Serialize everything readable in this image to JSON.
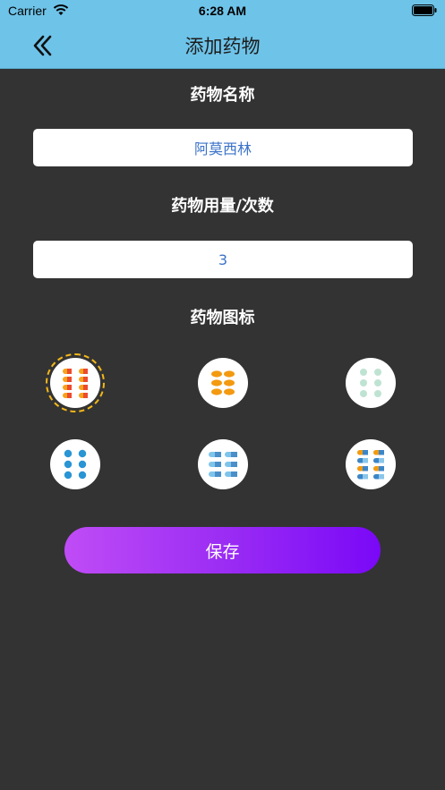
{
  "status_bar": {
    "carrier": "Carrier",
    "time": "6:28 AM"
  },
  "header": {
    "title": "添加药物",
    "back_icon": "double-chevron-left-icon",
    "background": "#6ec3e8"
  },
  "form": {
    "name_label": "药物名称",
    "name_value": "阿莫西林",
    "dosage_label": "药物用量/次数",
    "dosage_value": "3",
    "icon_label": "药物图标"
  },
  "pill_icons": [
    {
      "name": "orange-red-capsules-icon",
      "selected": true
    },
    {
      "name": "orange-tablets-icon",
      "selected": false
    },
    {
      "name": "mint-dots-icon",
      "selected": false
    },
    {
      "name": "blue-dots-icon",
      "selected": false
    },
    {
      "name": "blue-capsules-icon",
      "selected": false
    },
    {
      "name": "orange-blue-capsules-icon",
      "selected": false
    }
  ],
  "save_button": {
    "label": "保存"
  },
  "colors": {
    "background": "#333333",
    "accent_start": "#c04cf6",
    "accent_end": "#7a08f7",
    "selection": "#f2b619"
  }
}
